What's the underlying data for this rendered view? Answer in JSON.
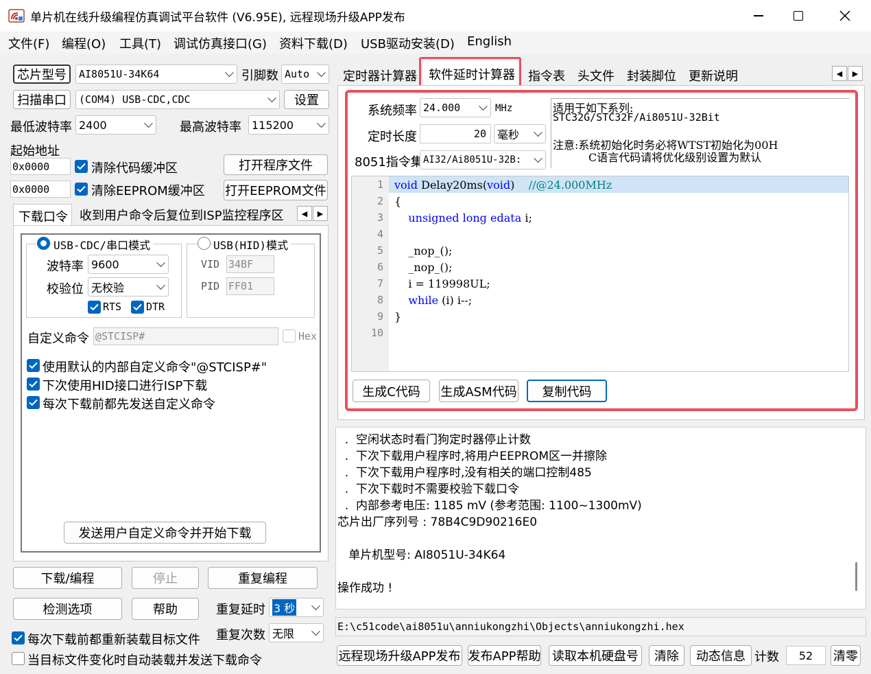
{
  "window": {
    "title": "单片机在线升级编程仿真调试平台软件 (V6.95E), 远程现场升级APP发布"
  },
  "menu": [
    "文件(F)",
    "编程(O)",
    "工具(T)",
    "调试仿真接口(G)",
    "资料下载(D)",
    "USB驱动安装(D)",
    "English"
  ],
  "left": {
    "chip_model_label": "芯片型号",
    "chip_model_value": "AI8051U-34K64",
    "pin_count_label": "引脚数",
    "pin_count_value": "Auto",
    "scan_port_button": "扫描串口",
    "port_value": "(COM4) USB-CDC,CDC",
    "settings_button": "设置",
    "min_baud_label": "最低波特率",
    "min_baud_value": "2400",
    "max_baud_label": "最高波特率",
    "max_baud_value": "115200",
    "start_addr_label": "起始地址",
    "addr1": "0x0000",
    "clear_code_label": "清除代码缓冲区",
    "open_program_button": "打开程序文件",
    "addr2": "0x0000",
    "clear_eeprom_label": "清除EEPROM缓冲区",
    "open_eeprom_button": "打开EEPROM文件",
    "subtabs": [
      "下载口令",
      "收到用户命令后复位到ISP监控程序区"
    ],
    "mode_cdc_label": "USB-CDC/串口模式",
    "mode_hid_label": "USB(HID)模式",
    "baud_label": "波特率",
    "baud_value": "9600",
    "parity_label": "校验位",
    "parity_value": "无校验",
    "rts_label": "RTS",
    "dtr_label": "DTR",
    "vid_label": "VID",
    "vid_value": "34BF",
    "pid_label": "PID",
    "pid_value": "FF01",
    "custom_cmd_label": "自定义命令",
    "custom_cmd_value": "@STCISP#",
    "hex_label": "Hex",
    "options": [
      "使用默认的内部自定义命令\"@STCISP#\"",
      "下次使用HID接口进行ISP下载",
      "每次下载前都先发送自定义命令"
    ],
    "send_cmd_button": "发送用户自定义命令并开始下载",
    "download_button": "下载/编程",
    "stop_button": "停止",
    "reprogram_button": "重复编程",
    "check_options_button": "检测选项",
    "help_button": "帮助",
    "repeat_delay_label": "重复延时",
    "repeat_delay_value": "3 秒",
    "repeat_count_label": "重复次数",
    "repeat_count_value": "无限",
    "reload_label": "每次下载前都重新装载目标文件",
    "autoload_label": "当目标文件变化时自动装载并发送下载命令"
  },
  "right": {
    "tabs": [
      "定时器计算器",
      "软件延时计算器",
      "指令表",
      "头文件",
      "封装脚位",
      "更新说明"
    ],
    "sys_freq_label": "系统频率",
    "sys_freq_value": "24.000",
    "sys_freq_unit": "MHz",
    "delay_len_label": "定时长度",
    "delay_len_value": "20",
    "delay_unit_value": "毫秒",
    "isa_label": "8051指令集",
    "isa_value": "AI32/Ai8051U-32B:",
    "info_lines": [
      "适用于如下系列:",
      "STC32G/STC32F/Ai8051U-32Bit",
      "注意:系统初始化时务必将WTST初始化为00H",
      "C语言代码请将优化级别设置为默认"
    ],
    "code_lines": [
      {
        "num": "1",
        "parts": [
          [
            "kw",
            "void"
          ],
          [
            "",
            " Delay20ms("
          ],
          [
            "kw",
            "void"
          ],
          [
            "",
            ")    "
          ],
          [
            "cm",
            "//@24.000MHz"
          ]
        ]
      },
      {
        "num": "2",
        "parts": [
          [
            "",
            "{"
          ]
        ]
      },
      {
        "num": "3",
        "parts": [
          [
            "",
            "    "
          ],
          [
            "kw",
            "unsigned long edata"
          ],
          [
            "",
            " i;"
          ]
        ]
      },
      {
        "num": "4",
        "parts": []
      },
      {
        "num": "5",
        "parts": [
          [
            "",
            "    _nop_();"
          ]
        ]
      },
      {
        "num": "6",
        "parts": [
          [
            "",
            "    _nop_();"
          ]
        ]
      },
      {
        "num": "7",
        "parts": [
          [
            "",
            "    i = 119998UL;"
          ]
        ]
      },
      {
        "num": "8",
        "parts": [
          [
            "",
            "    "
          ],
          [
            "kw",
            "while"
          ],
          [
            "",
            " (i) i--;"
          ]
        ]
      },
      {
        "num": "9",
        "parts": [
          [
            "",
            "}"
          ]
        ]
      },
      {
        "num": "10",
        "parts": []
      }
    ],
    "gen_c_button": "生成C代码",
    "gen_asm_button": "生成ASM代码",
    "copy_button": "复制代码",
    "log_lines": [
      "  .  空闲状态时看门狗定时器停止计数",
      "  .  下次下载用户程序时,将用户EEPROM区一并擦除",
      "  .  下次下载用户程序时,没有相关的端口控制485",
      "  .  下次下载时不需要校验下载口令",
      "  .  内部参考电压: 1185 mV (参考范围: 1100~1300mV)",
      "芯片出厂序列号 : 78B4C9D90216E0",
      "",
      "   单片机型号: AI8051U-34K64",
      "",
      "操作成功 !"
    ],
    "file_path": "E:\\c51code\\ai8051u\\anniukongzhi\\Objects\\anniukongzhi.hex",
    "remote_button": "远程现场升级APP发布",
    "app_help_button": "发布APP帮助",
    "read_disk_button": "读取本机硬盘号",
    "clear_button": "清除",
    "dynamic_button": "动态信息",
    "count_label": "计数",
    "count_value": "52",
    "reset_button": "清零"
  },
  "colors": {
    "accent": "#0067c0",
    "highlight_border": "#e8505b",
    "code_keyword": "#0000ff",
    "code_comment": "#008080",
    "selected_line": "#cfe4f6"
  }
}
